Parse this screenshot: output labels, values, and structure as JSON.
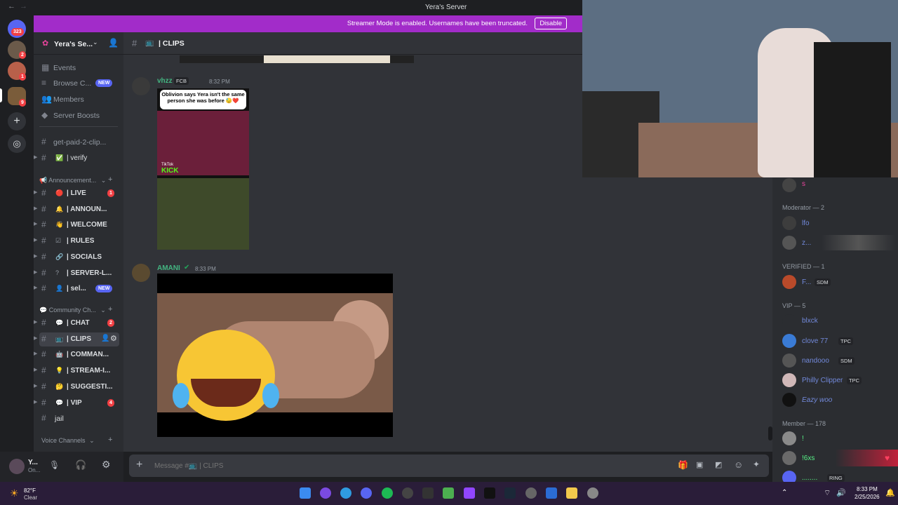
{
  "window": {
    "title": "Yera's Server",
    "back_icon": "arrow-left-icon",
    "forward_icon": "arrow-right-icon"
  },
  "banner": {
    "message": "Streamer Mode is enabled. Usernames have been truncated.",
    "button": "Disable",
    "color": "#a22cc9"
  },
  "guilds": {
    "home_badge": "323",
    "badges": [
      "2",
      "1",
      "9"
    ]
  },
  "server": {
    "name": "Yera's Se...",
    "items": [
      {
        "label": "Events"
      },
      {
        "label": "Browse C...",
        "badge": "NEW"
      },
      {
        "label": "Members"
      },
      {
        "label": "Server Boosts"
      }
    ]
  },
  "channels": {
    "top": [
      {
        "label": "get-paid-2-clip..."
      },
      {
        "emoji": "✅",
        "label": "| verify"
      }
    ],
    "cat1": {
      "label": "Announcement...",
      "items": [
        {
          "emoji": "🔴",
          "label": "| LIVE",
          "badge": "1"
        },
        {
          "emoji": "🔔",
          "label": "| ANNOUN..."
        },
        {
          "emoji": "👋",
          "label": "| WELCOME"
        },
        {
          "emoji": "☑",
          "label": "| RULES"
        },
        {
          "emoji": "🔗",
          "label": "| SOCIALS"
        },
        {
          "emoji": "?",
          "label": "| SERVER-L..."
        },
        {
          "emoji": "👤",
          "label": "| sel...",
          "badge": "NEW"
        }
      ]
    },
    "cat2": {
      "label": "Community Ch...",
      "items": [
        {
          "emoji": "💬",
          "label": "| CHAT",
          "badge": "2"
        },
        {
          "emoji": "📺",
          "label": "| CLIPS",
          "selected": true
        },
        {
          "emoji": "🤖",
          "label": "| COMMAN..."
        },
        {
          "emoji": "💡",
          "label": "| STREAM-I..."
        },
        {
          "emoji": "🤔",
          "label": "| SUGGESTI..."
        },
        {
          "emoji": "💬",
          "label": "| VIP",
          "badge": "4"
        }
      ]
    },
    "jail": "jail",
    "voice": "Voice Channels"
  },
  "user": {
    "name": "Y...",
    "status": "On..."
  },
  "channel": {
    "name": "| CLIPS",
    "emoji": "📺"
  },
  "messages": [
    {
      "author": "vhzz",
      "tag": "FCB",
      "time": "8:32 PM",
      "media_caption": "Oblivion says Yera isn't the same person she was before 😓❤️",
      "media_tiktok": "TikTok",
      "media_kick": "KICK"
    },
    {
      "author": "AMANI",
      "time": "8:33 PM"
    }
  ],
  "composer": {
    "placeholder": "Message #📺 | CLIPS"
  },
  "members": {
    "sections": [
      {
        "label": "Moderator — 2"
      },
      {
        "label": "VERIFIED — 1"
      },
      {
        "label": "VIP — 5"
      },
      {
        "label": "Member — 178"
      }
    ],
    "top_name": "s",
    "moderators": [
      {
        "name": "lfo"
      },
      {
        "name": "z..."
      }
    ],
    "verified": [
      {
        "name": "F...",
        "tag": "SDM"
      }
    ],
    "vip": [
      {
        "name": "blxck"
      },
      {
        "name": "clove 77",
        "tag": "TPC"
      },
      {
        "name": "nandooo",
        "tag": "SDM"
      },
      {
        "name": "Philly Clipper",
        "tag": "TPC"
      },
      {
        "name": "Eazy woo"
      }
    ],
    "member": [
      {
        "name": "!"
      },
      {
        "name": "!6xs"
      },
      {
        "name": "........",
        "tag": "RING"
      }
    ]
  },
  "taskbar": {
    "weather_temp": "82°F",
    "weather_desc": "Clear",
    "time": "8:33 PM",
    "date": "2/25/2026"
  }
}
